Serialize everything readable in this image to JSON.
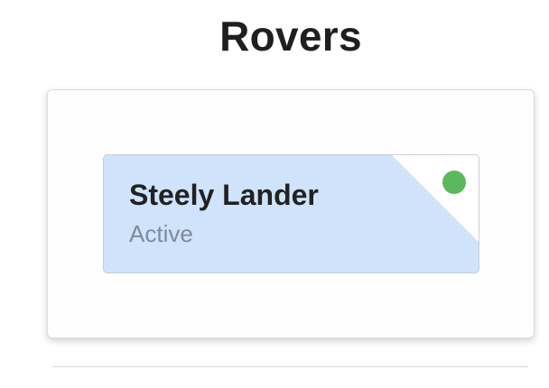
{
  "page": {
    "title": "Rovers"
  },
  "rovers": [
    {
      "name": "Steely Lander",
      "status": "Active",
      "status_color": "#5cb85c",
      "card_color": "#cfe3fb"
    }
  ],
  "icons": {
    "status": "status-dot-icon"
  }
}
